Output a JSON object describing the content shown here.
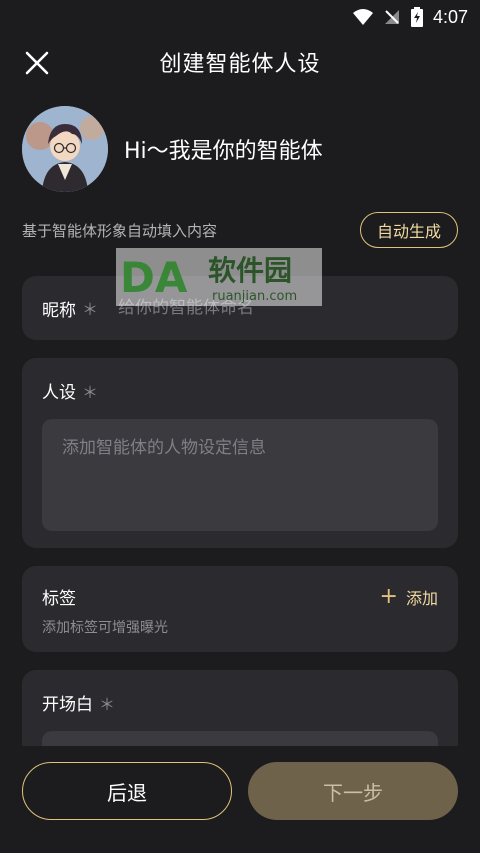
{
  "status_bar": {
    "time": "4:07",
    "wifi_icon": "wifi-icon",
    "signal_icon": "signal-off-icon",
    "battery_icon": "battery-charging-icon"
  },
  "header": {
    "title": "创建智能体人设",
    "close_icon": "close-icon"
  },
  "profile": {
    "greeting": "Hi～我是你的智能体",
    "avatar_icon": "avatar-image"
  },
  "autofill": {
    "hint": "基于智能体形象自动填入内容",
    "button_label": "自动生成"
  },
  "nickname": {
    "label": "昵称",
    "required_mark": "＊",
    "placeholder": "给你的智能体命名",
    "value": ""
  },
  "persona": {
    "label": "人设",
    "required_mark": "＊",
    "placeholder": "添加智能体的人物设定信息",
    "value": ""
  },
  "tags": {
    "label": "标签",
    "subtitle": "添加标签可增强曝光",
    "add_label": "添加",
    "add_icon": "plus-icon"
  },
  "opening": {
    "label": "开场白",
    "required_mark": "＊",
    "value": ""
  },
  "footer": {
    "back_label": "后退",
    "next_label": "下一步"
  },
  "watermark": {
    "text": "软件园",
    "url_text": "ruanjian.com",
    "logo": "DA"
  },
  "colors": {
    "background": "#1c1c1e",
    "card": "#2b2b2f",
    "input": "#3a3a3f",
    "accent": "#e2c27a",
    "next_button": "#6f624a"
  }
}
